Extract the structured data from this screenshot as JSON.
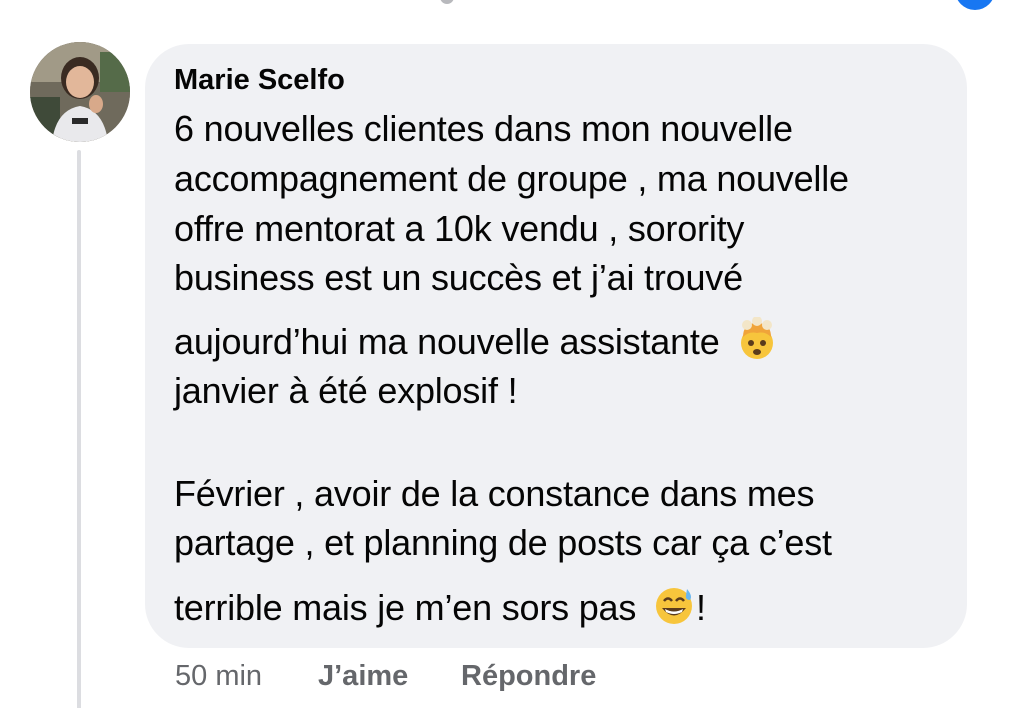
{
  "comment": {
    "author": "Marie Scelfo",
    "lines": [
      "6 nouvelles clientes dans mon nouvelle",
      "accompagnement de groupe , ma nouvelle",
      "offre mentorat a 10k vendu , sorority",
      "business est un succès et j’ai trouvé",
      "aujourd’hui ma nouvelle assistante",
      "janvier à été explosif !",
      "Février , avoir de la constance dans mes",
      "partage , et planning de posts car ça c’est",
      "terrible mais je m’en sors pas",
      "!"
    ],
    "emojis": {
      "line5": "exploding-head-emoji",
      "line9": "grinning-sweat-emoji"
    }
  },
  "actions": {
    "time": "50 min",
    "like_label": "J’aime",
    "reply_label": "Répondre"
  },
  "colors": {
    "bubble": "#f0f1f4",
    "text": "#050505",
    "meta": "#65676b",
    "thread_line": "#dcdde1",
    "accent": "#1877f2"
  }
}
